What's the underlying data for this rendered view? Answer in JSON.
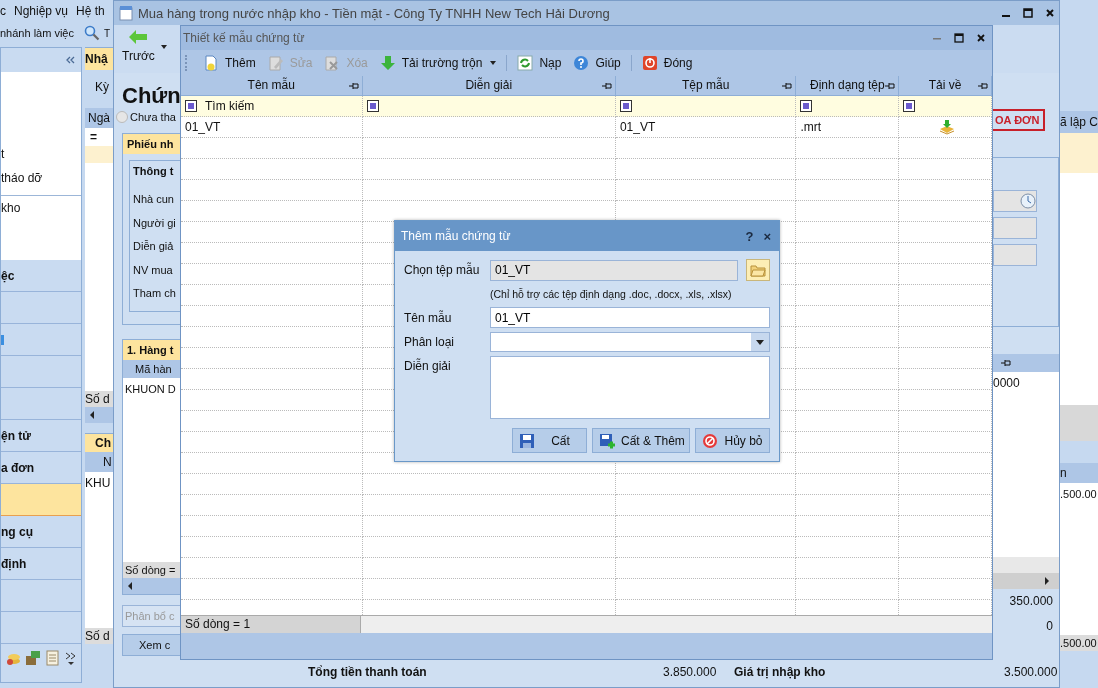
{
  "background_app": {
    "menu": [
      "c",
      "Nghiệp vụ",
      "Hệ th"
    ],
    "branch_label": "nhánh làm việc",
    "search_text": "T",
    "sidebar": {
      "items": [
        "t",
        "tháo dỡ",
        "kho"
      ],
      "groups": [
        {
          "kind": "text",
          "label": "ệc",
          "selected": false
        },
        {
          "kind": "empty",
          "selected": false
        },
        {
          "kind": "icon",
          "selected": false
        },
        {
          "kind": "empty",
          "selected": false
        },
        {
          "kind": "empty",
          "selected": false
        },
        {
          "kind": "text",
          "label": "ện tử",
          "selected": false
        },
        {
          "kind": "text",
          "label": "a đơn",
          "selected": false
        },
        {
          "kind": "empty",
          "selected": true
        },
        {
          "kind": "text",
          "label": "ng cụ",
          "selected": false
        },
        {
          "kind": "text",
          "label": "định",
          "selected": false
        },
        {
          "kind": "empty",
          "selected": false
        },
        {
          "kind": "empty",
          "selected": false
        }
      ]
    },
    "list_strip": {
      "tab": "Nhậ",
      "period_label": "Kỳ",
      "column_1": "Ngà",
      "filter": "=",
      "footer": "Số d",
      "detail_tab": "Ch",
      "detail_column": "N",
      "detail_cell": "KHU",
      "detail_footer": "Số d"
    },
    "right_strip": {
      "column": "ã lập C",
      "detail_column": "n",
      "detail_cell": ".500.00",
      "detail_footer": ".500.00"
    }
  },
  "purchase_window": {
    "title": "Mua hàng trong nước nhập kho - Tiền mặt - Công Ty TNHH New Tech Hải Dương",
    "back_button": "Trước",
    "heading": "Chứn",
    "radio": {
      "label": "Chưa tha",
      "checked": false
    },
    "voucher_tab": "Phiếu nh",
    "group_title": "Thông t",
    "field_labels": [
      "Nhà cun",
      "Người gi",
      "Diễn giả",
      "NV mua",
      "Tham ch"
    ],
    "goods_tab": "1. Hàng t",
    "goods_column": "Mã hàn",
    "goods_cell": "KHUON D",
    "goods_footer": "Số dòng =",
    "allocate_button": "Phân bổ c",
    "view_button": "Xem c",
    "invoice_badge": "OA ĐƠN",
    "amount_cell": "0000",
    "totals": [
      {
        "label": "Tổng tiền thanh toán",
        "value": "3.850.000"
      },
      {
        "label": "Giá trị nhập kho",
        "value": "3.500.000"
      }
    ],
    "side_values": [
      "350.000",
      "0"
    ]
  },
  "template_window": {
    "title": "Thiết kế mẫu chứng từ",
    "toolbar": [
      {
        "kind": "add",
        "label": "Thêm",
        "disabled": false
      },
      {
        "kind": "edit",
        "label": "Sửa",
        "disabled": true
      },
      {
        "kind": "delete",
        "label": "Xóa",
        "disabled": true
      },
      {
        "kind": "merge",
        "label": "Tải trường trộn",
        "disabled": false
      },
      {
        "kind": "reload",
        "label": "Nạp",
        "disabled": false
      },
      {
        "kind": "help",
        "label": "Giúp",
        "disabled": false
      },
      {
        "kind": "close",
        "label": "Đóng",
        "disabled": false
      }
    ],
    "table": {
      "columns": [
        "Tên mẫu",
        "Diễn giải",
        "Tệp mẫu",
        "Định dạng tệp",
        "Tải về"
      ],
      "search_placeholder": "Tìm kiếm",
      "rows": [
        {
          "template_name": "01_VT",
          "template_file": "01_VT",
          "file_format": ".mrt"
        }
      ]
    },
    "status": "Số dòng = 1"
  },
  "dialog": {
    "title": "Thêm mẫu chứng từ",
    "help": "?",
    "close": "×",
    "file_label": "Chọn tệp mẫu",
    "file_value": "01_VT",
    "hint": "(Chỉ hỗ trợ các tệp định dạng .doc, .docx, .xls, .xlsx)",
    "name_label": "Tên mẫu",
    "name_value": "01_VT",
    "category_label": "Phân loại",
    "description_label": "Diễn giải",
    "buttons": [
      {
        "kind": "save",
        "label": "Cất"
      },
      {
        "kind": "save_add",
        "label": "Cất & Thêm"
      },
      {
        "kind": "cancel",
        "label": "Hủy bỏ"
      }
    ]
  }
}
